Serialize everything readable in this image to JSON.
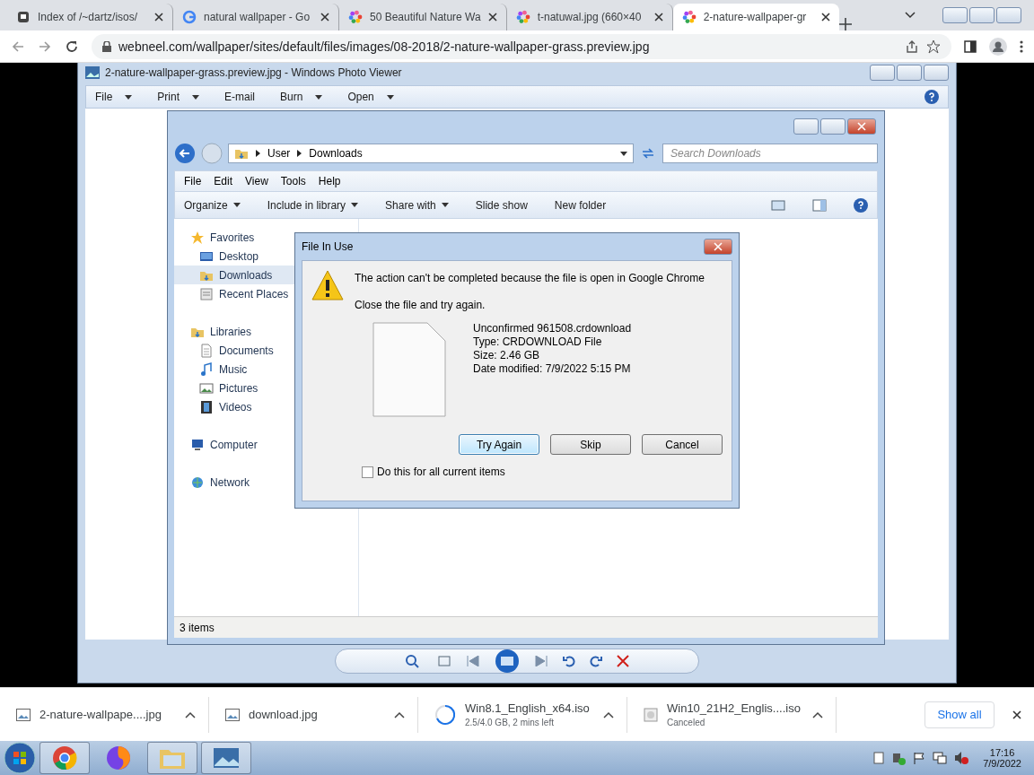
{
  "browser": {
    "tabs": [
      {
        "title": "Index of /~dartz/isos/",
        "selected": false
      },
      {
        "title": "natural wallpaper - Go",
        "selected": false
      },
      {
        "title": "50 Beautiful Nature Wa",
        "selected": false
      },
      {
        "title": "t-natuwal.jpg (660×40",
        "selected": false
      },
      {
        "title": "2-nature-wallpaper-gr",
        "selected": true
      }
    ],
    "url": "webneel.com/wallpaper/sites/default/files/images/08-2018/2-nature-wallpaper-grass.preview.jpg"
  },
  "photo_viewer": {
    "title": "2-nature-wallpaper-grass.preview.jpg - Windows Photo Viewer",
    "menu": [
      {
        "label": "File",
        "dropdown": true
      },
      {
        "label": "Print",
        "dropdown": true
      },
      {
        "label": "E-mail",
        "dropdown": false
      },
      {
        "label": "Burn",
        "dropdown": true
      },
      {
        "label": "Open",
        "dropdown": true
      }
    ]
  },
  "explorer": {
    "breadcrumb": [
      "User",
      "Downloads"
    ],
    "search_placeholder": "Search Downloads",
    "menu": [
      "File",
      "Edit",
      "View",
      "Tools",
      "Help"
    ],
    "commands": [
      {
        "label": "Organize",
        "dropdown": true
      },
      {
        "label": "Include in library",
        "dropdown": true
      },
      {
        "label": "Share with",
        "dropdown": true
      },
      {
        "label": "Slide show",
        "dropdown": false
      },
      {
        "label": "New folder",
        "dropdown": false
      }
    ],
    "sidebar": [
      {
        "label": "Favorites",
        "selected": false,
        "children": [
          {
            "label": "Desktop",
            "selected": false
          },
          {
            "label": "Downloads",
            "selected": true
          },
          {
            "label": "Recent Places",
            "selected": false
          }
        ]
      },
      {
        "label": "Libraries",
        "selected": false,
        "children": [
          {
            "label": "Documents",
            "selected": false
          },
          {
            "label": "Music",
            "selected": false
          },
          {
            "label": "Pictures",
            "selected": false
          },
          {
            "label": "Videos",
            "selected": false
          }
        ]
      },
      {
        "label": "Computer",
        "selected": false
      },
      {
        "label": "Network",
        "selected": false
      }
    ],
    "status": "3 items"
  },
  "dialog": {
    "title": "File In Use",
    "message": "The action can't be completed because the file is open in Google Chrome",
    "hint": "Close the file and try again.",
    "file": [
      "Unconfirmed 961508.crdownload",
      "Type: CRDOWNLOAD File",
      "Size: 2.46 GB",
      "Date modified: 7/9/2022 5:15 PM"
    ],
    "buttons": [
      {
        "label": "Try Again",
        "default": true
      },
      {
        "label": "Skip",
        "default": false
      },
      {
        "label": "Cancel",
        "default": false
      }
    ],
    "checkbox": {
      "label": "Do this for all current items",
      "checked": false
    }
  },
  "downloads": {
    "items": [
      {
        "name": "2-nature-wallpape....jpg",
        "kind": "image"
      },
      {
        "name": "download.jpg",
        "kind": "image"
      },
      {
        "name": "Win8.1_English_x64.iso",
        "status": "2.5/4.0 GB, 2 mins left",
        "kind": "progress"
      },
      {
        "name": "Win10_21H2_Englis....iso",
        "status": "Canceled",
        "kind": "file"
      }
    ],
    "show_all": "Show all"
  },
  "taskbar": {
    "time": "17:16",
    "date": "7/9/2022"
  }
}
